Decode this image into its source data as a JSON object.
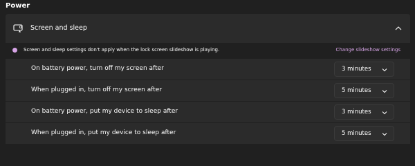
{
  "section": {
    "title": "Power"
  },
  "expander": {
    "label": "Screen and sleep",
    "icon": "screen-sleep-icon",
    "expanded": true
  },
  "info": {
    "text": "Screen and sleep settings don't apply when the lock screen slideshow is playing.",
    "link": "Change slideshow settings",
    "accent_color": "#d6a4e6"
  },
  "settings": [
    {
      "label": "On battery power, turn off my screen after",
      "value": "3 minutes"
    },
    {
      "label": "When plugged in, turn off my screen after",
      "value": "5 minutes"
    },
    {
      "label": "On battery power, put my device to sleep after",
      "value": "3 minutes"
    },
    {
      "label": "When plugged in, put my device to sleep after",
      "value": "5 minutes"
    }
  ]
}
